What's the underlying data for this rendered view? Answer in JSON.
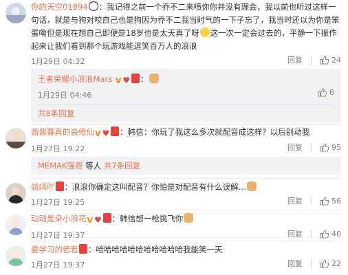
{
  "comments": [
    {
      "user": "你的天空01894",
      "text": "：我记得之前一个乔不二来喷你你并没有理会，我以前也听过这样一句话，就是与狗对咬自己也是狗因为乔不二我当时气的一下子忘了，我当时还以为你是笨蛋嘞但是现在想自己即便是18岁也是太天真了呀",
      "text2": "这一次一定会过去的，平静一下振作起来让我们看到那个玩游戏能逗笑百万人的浪浪",
      "time": "1月29日 04:32",
      "reply": "回复",
      "likes": "24",
      "nested": {
        "user": "王者荣耀小浪浪Mars",
        "time": "1月29日 04:46",
        "likes": "6",
        "more": "共8条回复"
      }
    },
    {
      "user": "酱酱賽真的会修仙",
      "text": "：韩信：你玩了我这么多次就配音成这样？以后别动我",
      "time": "1月27日 19:22",
      "reply": "回复",
      "likes": "95",
      "subline": {
        "user": "MEMAK强哥",
        "mid": "等人",
        "more": "共7条回复"
      }
    },
    {
      "user": "靖靖吖",
      "text": "：浪浪你确定这叫配音？你怕是对配音有什么误解…",
      "time": "1月27日 19:25",
      "reply": "回复",
      "likes": "56"
    },
    {
      "user": "动动是朵小浪花",
      "text": "：韩信想一枪挑飞你",
      "time": "1月27日 19:37",
      "reply": "回复",
      "likes": "40"
    },
    {
      "user": "要学习的若若",
      "text": "：哈哈哈哈哈哈哈哈哈哈哈我能笑一天",
      "time": "1月27日 19:37",
      "reply": "回复",
      "likes": "22"
    }
  ],
  "colors": {
    "link": "#eb7350",
    "meta": "#808080",
    "subbg": "#f2f2f5"
  }
}
